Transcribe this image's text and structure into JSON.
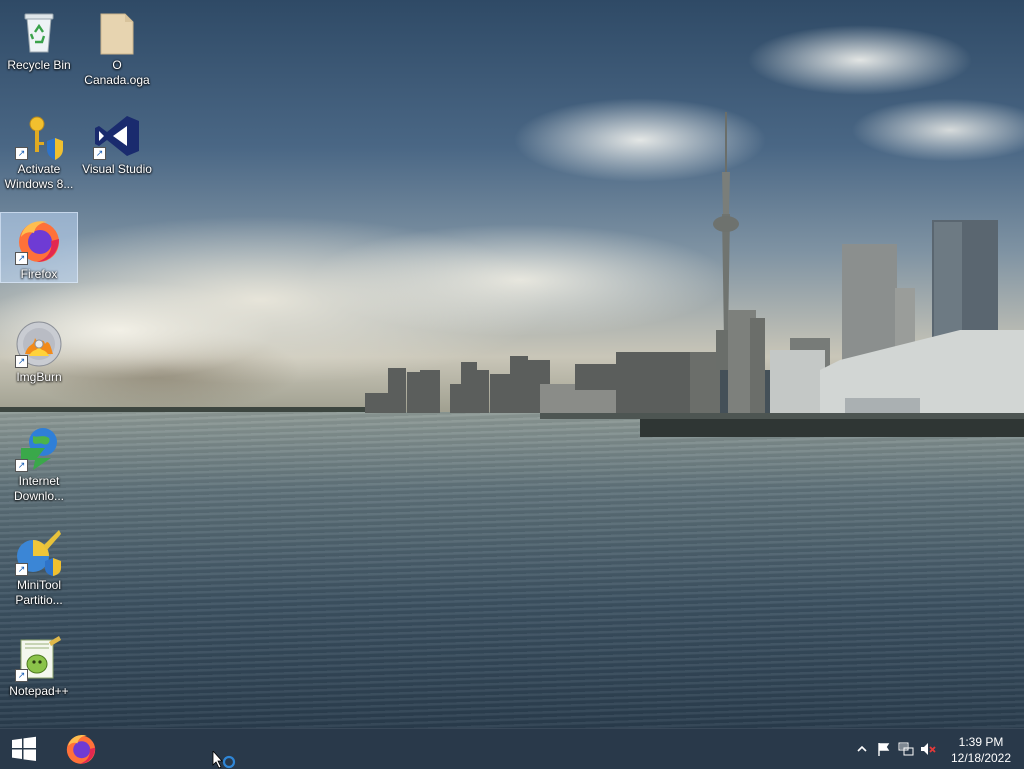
{
  "desktop": {
    "icons": [
      {
        "label": "Recycle Bin",
        "icon": "recycle-bin-icon"
      },
      {
        "label": "O\nCanada.oga",
        "icon": "audio-file-icon"
      },
      {
        "label": "Activate\nWindows 8...",
        "icon": "key-shield-icon"
      },
      {
        "label": "Visual Studio",
        "icon": "visual-studio-icon"
      },
      {
        "label": "Firefox",
        "icon": "firefox-icon"
      },
      {
        "label": "ImgBurn",
        "icon": "imgburn-icon"
      },
      {
        "label": "Internet\nDownlo...",
        "icon": "internet-download-manager-icon"
      },
      {
        "label": "MiniTool\nPartitio...",
        "icon": "minitool-partition-icon"
      },
      {
        "label": "Notepad++",
        "icon": "notepadpp-icon"
      }
    ]
  },
  "taskbar": {
    "start_icon": "windows-start-icon",
    "pinned": [
      {
        "name": "Firefox",
        "icon": "firefox-icon"
      }
    ],
    "tray": {
      "icons": [
        "chevron-up-icon",
        "flag-icon",
        "network-icon",
        "volume-muted-icon"
      ],
      "time": "1:39 PM",
      "date": "12/18/2022"
    }
  },
  "colors": {
    "taskbar": "#28374680",
    "selection": "#bed7f5"
  }
}
